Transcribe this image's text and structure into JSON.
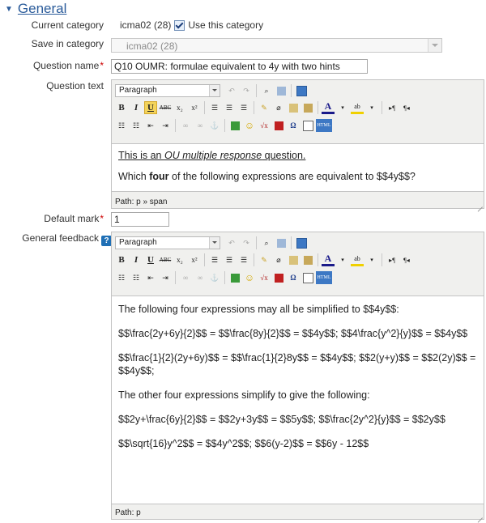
{
  "section": {
    "title": "General"
  },
  "current_category": {
    "label": "Current category",
    "value": "icma02 (28)",
    "checkbox_label": "Use this category",
    "checked": true
  },
  "save_in_category": {
    "label": "Save in category",
    "value": "icma02 (28)"
  },
  "question_name": {
    "label": "Question name",
    "value": "Q10 OUMR: formulae equivalent to 4y with two hints"
  },
  "question_text": {
    "label": "Question text",
    "format": "Paragraph",
    "line1_a": "This is an ",
    "line1_b": "OU multiple response",
    "line1_c": " question.",
    "line2_a": "Which ",
    "line2_b": "four",
    "line2_c": " of the following expressions are equivalent to $$4y$$?",
    "path": "Path: p » span"
  },
  "default_mark": {
    "label": "Default mark",
    "value": "1"
  },
  "general_feedback": {
    "label": "General feedback",
    "format": "Paragraph",
    "paragraphs": [
      "The following four expressions may all be simplified to $$4y$$:",
      "$$\\frac{2y+6y}{2}$$ = $$\\frac{8y}{2}$$ = $$4y$$; $$4\\frac{y^2}{y}$$ = $$4y$$",
      "$$\\frac{1}{2}(2y+6y)$$ = $$\\frac{1}{2}8y$$ = $$4y$$; $$2(y+y)$$ = $$2(2y)$$ = $$4y$$;",
      "The other four expressions simplify to give the following:",
      "$$2y+\\frac{6y}{2}$$ = $$2y+3y$$ = $$5y$$; $$\\frac{2y^2}{y}$$ = $$2y$$",
      "$$\\sqrt{16}y^2$$ = $$4y^2$$; $$6(y-2)$$ = $$6y - 12$$"
    ],
    "path": "Path: p"
  },
  "toolbar": {
    "row2": [
      "B",
      "I",
      "U",
      "ABC",
      "x₂",
      "x²"
    ],
    "html_label": "HTML"
  }
}
